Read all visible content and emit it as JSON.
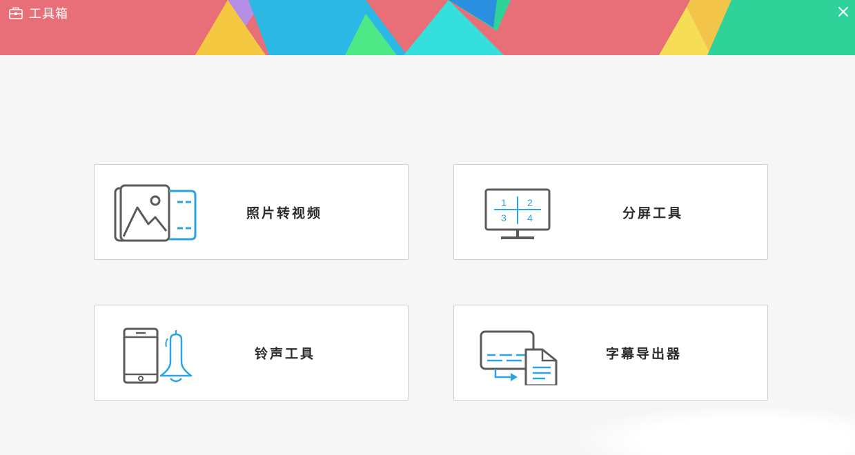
{
  "window": {
    "title": "工具箱",
    "close_glyph": "×"
  },
  "colors": {
    "banner_red": "#e86f77",
    "banner_yellow": "#f5c842",
    "banner_blue": "#2bb8e4",
    "banner_green": "#2fd39a",
    "banner_cyan": "#35e0dc",
    "banner_purple": "#b58ee6",
    "icon_gray": "#5a5a5a",
    "icon_blue": "#2aa3e2"
  },
  "tools": [
    {
      "label": "照片转视频",
      "icon": "photo-to-video-icon"
    },
    {
      "label": "分屏工具",
      "icon": "split-screen-icon",
      "grid_numbers": [
        "1",
        "2",
        "3",
        "4"
      ]
    },
    {
      "label": "铃声工具",
      "icon": "ringtone-icon"
    },
    {
      "label": "字幕导出器",
      "icon": "subtitle-export-icon"
    }
  ]
}
